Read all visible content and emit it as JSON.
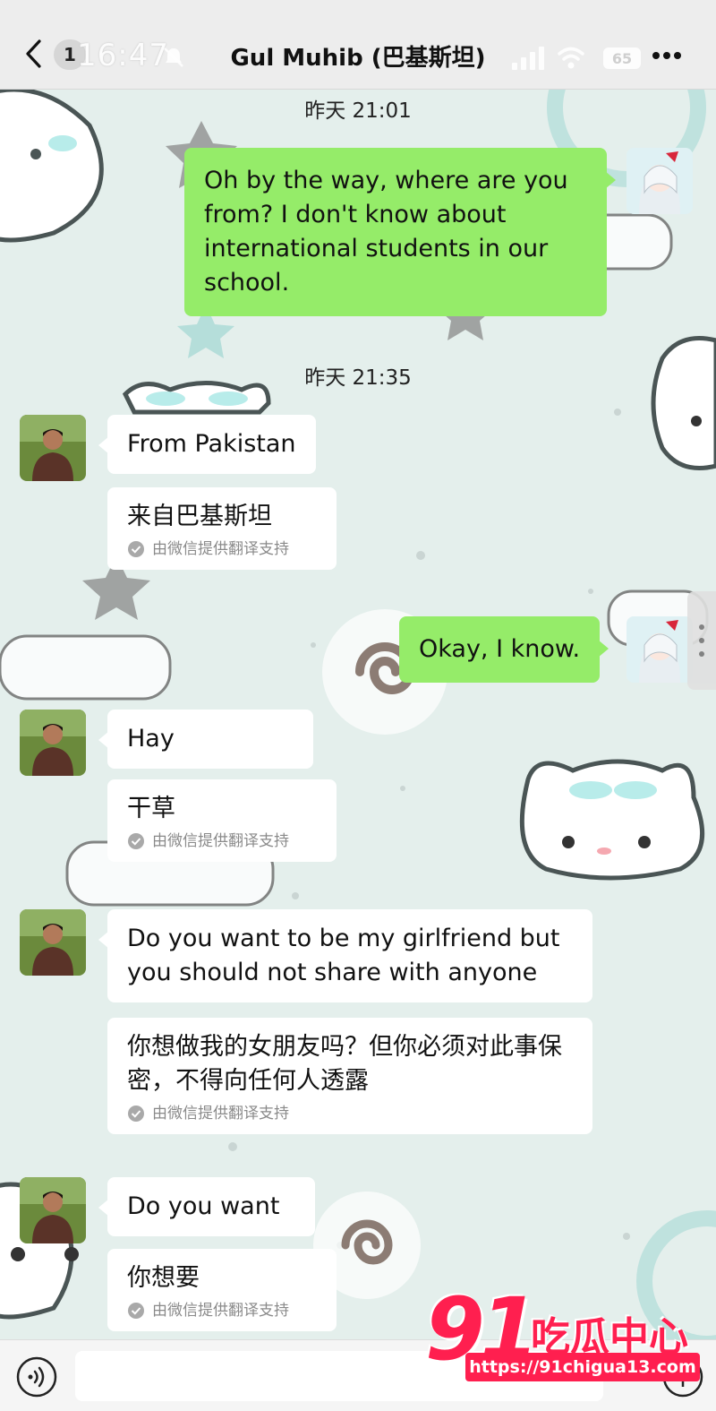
{
  "header": {
    "unread_count": "1",
    "status_time": "16:47",
    "title": "Gul Muhib (巴基斯坦)",
    "battery": "65",
    "icons": [
      "back-icon",
      "mute-icon",
      "signal-icon",
      "wifi-icon",
      "more-icon"
    ]
  },
  "colors": {
    "my_bubble": "#95ec69",
    "their_bubble": "#ffffff",
    "watermark": "#ff1f4f"
  },
  "messages": {
    "ts1": "昨天 21:01",
    "m1": "Oh by the way, where are you from? I don't know about international students in our school.",
    "ts2": "昨天 21:35",
    "m2": "From Pakistan",
    "m2_tr": "来自巴基斯坦",
    "m3": "Okay, I know.",
    "m4": "Hay",
    "m4_tr": "干草",
    "m5": "Do you want to be my girlfriend but you should not share with anyone",
    "m5_tr": "你想做我的女朋友吗？但你必须对此事保密，不得向任何人透露",
    "m6": "Do you want",
    "m6_tr": "你想要",
    "tr_note": "由微信提供翻译支持"
  },
  "input_bar": {
    "icons": [
      "voice-icon",
      "add-icon"
    ]
  },
  "watermark": {
    "number": "91",
    "title": "吃瓜中心",
    "url": "https://91chigua13.com"
  }
}
